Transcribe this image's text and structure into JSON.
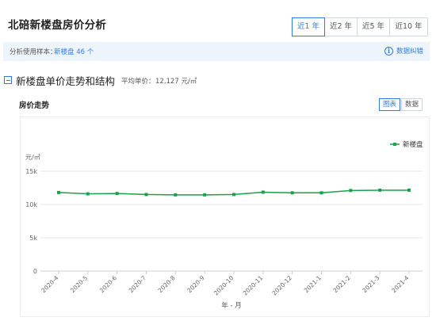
{
  "header": {
    "title": "北碚新楼盘房价分析"
  },
  "period_tabs": [
    {
      "label": "近1 年",
      "active": true
    },
    {
      "label": "近2 年",
      "active": false
    },
    {
      "label": "近5 年",
      "active": false
    },
    {
      "label": "近10 年",
      "active": false
    }
  ],
  "sample_bar": {
    "label": "分析使用样本：",
    "value": "新楼盘 46 个",
    "feedback_label": "数据纠错",
    "feedback_icon": "i"
  },
  "section": {
    "title": "新楼盘单价走势和结构",
    "avg_label": "平均单价：",
    "avg_value": "12,127 元/㎡"
  },
  "trend": {
    "title": "房价走势",
    "view_buttons": [
      {
        "label": "图表",
        "active": true
      },
      {
        "label": "数据",
        "active": false
      }
    ]
  },
  "colors": {
    "accent": "#2f7be5",
    "series": "#1aa14a"
  },
  "chart_data": {
    "type": "line",
    "xlabel": "年 - 月",
    "ylabel": "元/㎡",
    "ylim": [
      0,
      15000
    ],
    "y_ticks": [
      0,
      5000,
      10000,
      15000
    ],
    "y_tick_labels": [
      "0",
      "5k",
      "10k",
      "15k"
    ],
    "grid": true,
    "legend_position": "top-right",
    "categories": [
      "2020-4",
      "2020-5",
      "2020-6",
      "2020-7",
      "2020-8",
      "2020-9",
      "2020-10",
      "2020-11",
      "2020-12",
      "2021-1",
      "2021-2",
      "2021-3",
      "2021-4"
    ],
    "series": [
      {
        "name": "新楼盘",
        "values": [
          11800,
          11600,
          11650,
          11500,
          11450,
          11450,
          11500,
          11850,
          11750,
          11750,
          12100,
          12150,
          12150
        ]
      }
    ]
  }
}
